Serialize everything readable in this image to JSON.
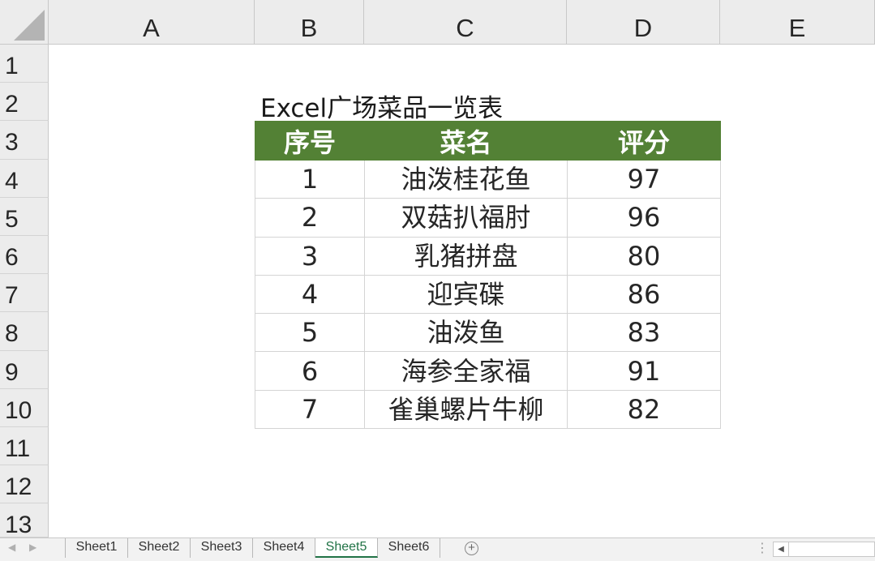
{
  "columns": [
    "A",
    "B",
    "C",
    "D",
    "E"
  ],
  "rows": [
    "1",
    "2",
    "3",
    "4",
    "5",
    "6",
    "7",
    "8",
    "9",
    "10",
    "11",
    "12",
    "13"
  ],
  "sheet": {
    "title": "Excel广场菜品一览表",
    "headers": [
      "序号",
      "菜名",
      "评分"
    ],
    "rows": [
      [
        "1",
        "油泼桂花鱼",
        "97"
      ],
      [
        "2",
        "双菇扒福肘",
        "96"
      ],
      [
        "3",
        "乳猪拼盘",
        "80"
      ],
      [
        "4",
        "迎宾碟",
        "86"
      ],
      [
        "5",
        "油泼鱼",
        "83"
      ],
      [
        "6",
        "海参全家福",
        "91"
      ],
      [
        "7",
        "雀巢螺片牛柳",
        "82"
      ]
    ]
  },
  "tabs": [
    "Sheet1",
    "Sheet2",
    "Sheet3",
    "Sheet4",
    "Sheet5",
    "Sheet6"
  ],
  "active_tab": "Sheet5",
  "colors": {
    "header_fill": "#538135",
    "accent": "#217346"
  },
  "icons": {
    "add_sheet": "plus-circle-icon"
  }
}
